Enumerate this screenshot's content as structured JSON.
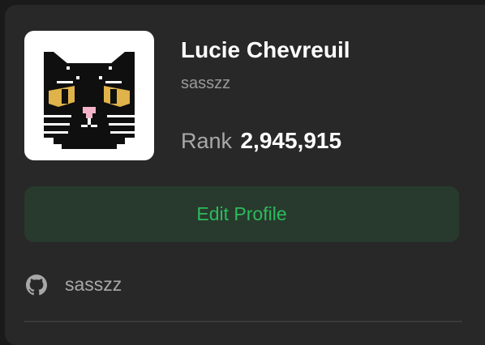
{
  "profile": {
    "name": "Lucie Chevreuil",
    "username": "sasszz",
    "rank_label": "Rank",
    "rank_value": "2,945,915",
    "avatar_icon": "pixel-cat-icon"
  },
  "actions": {
    "edit_label": "Edit Profile"
  },
  "socials": {
    "github_icon": "github-icon",
    "github_label": "sasszz"
  },
  "colors": {
    "background": "#1a1a1a",
    "card": "#282828",
    "accent_green": "#2cbb5d",
    "button_bg": "#283a2d"
  }
}
